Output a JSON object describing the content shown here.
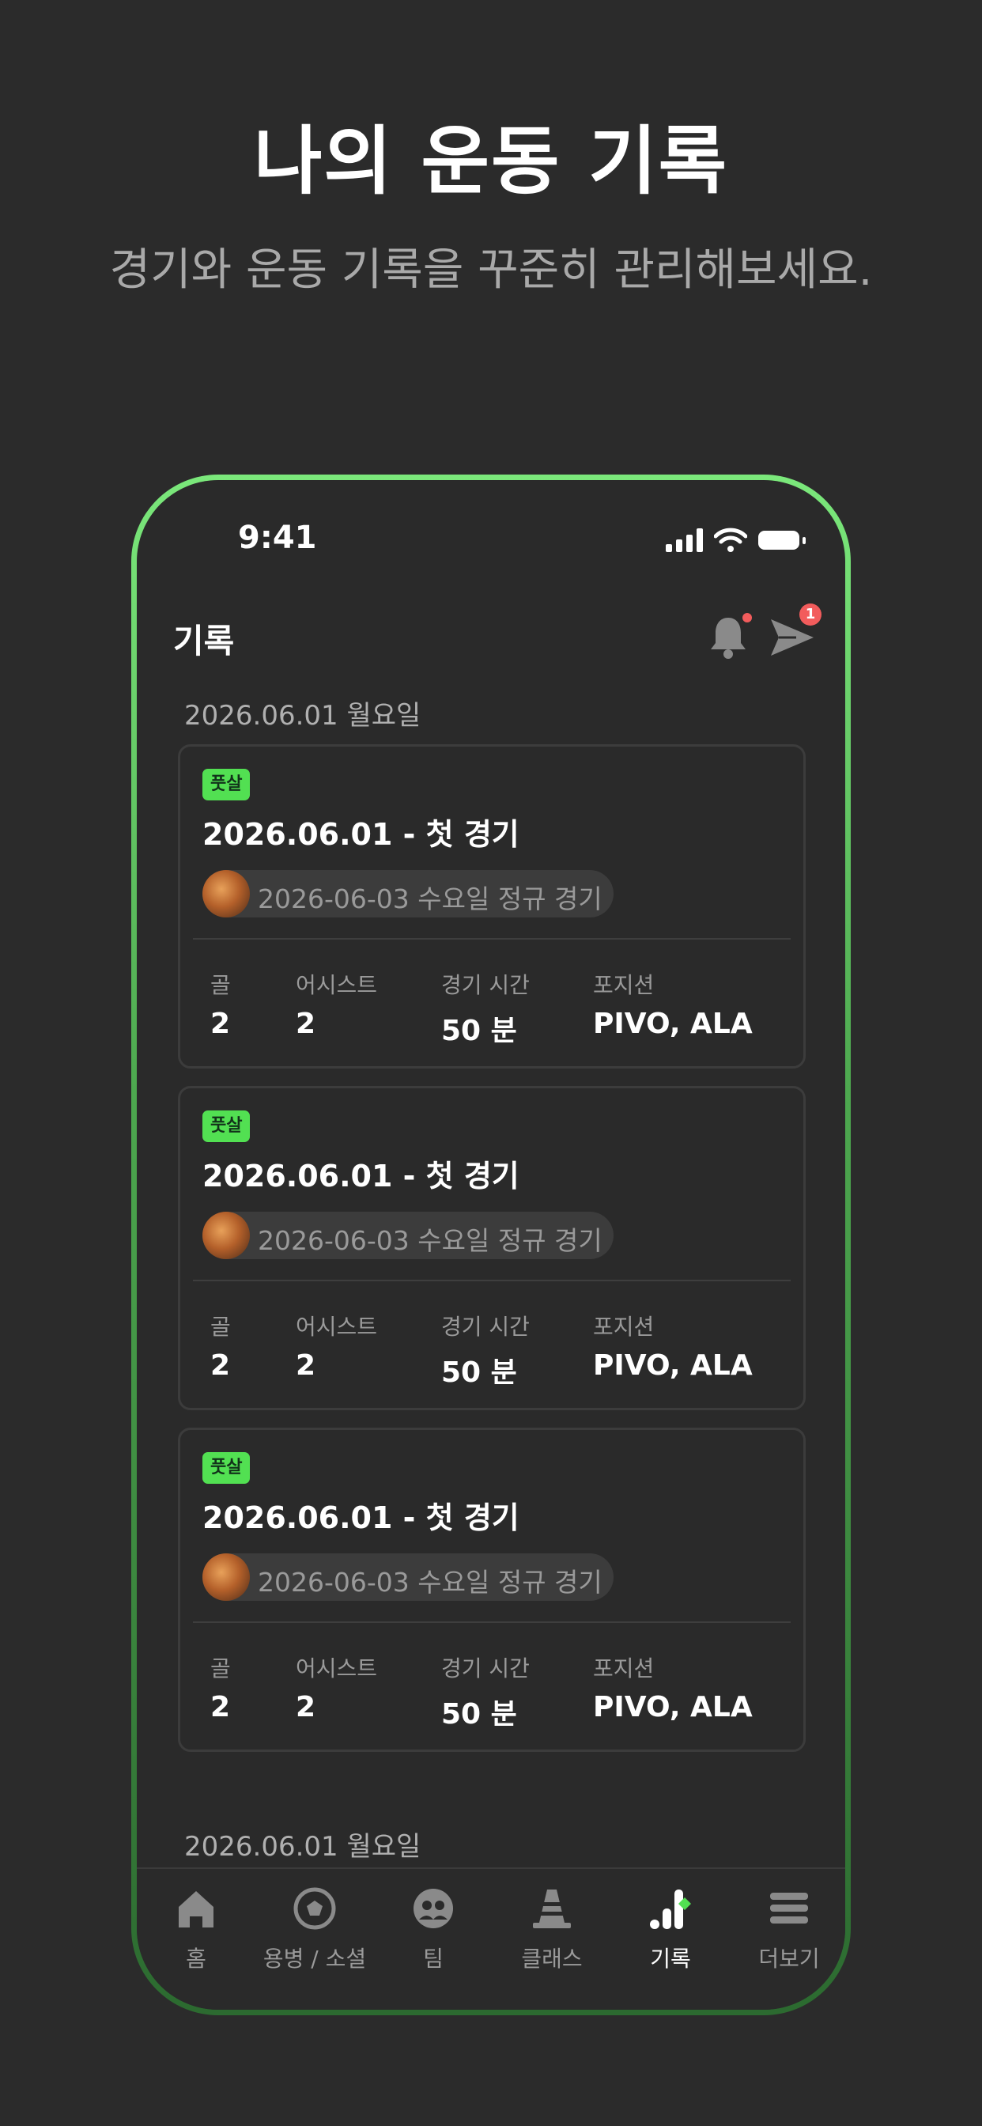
{
  "hero": {
    "title": "나의 운동 기록",
    "subtitle": "경기와 운동 기록을 꾸준히 관리해보세요."
  },
  "status_bar": {
    "time": "9:41"
  },
  "header": {
    "title": "기록",
    "send_badge": "1"
  },
  "sections": [
    {
      "date": "2026.06.01 월요일",
      "cards": [
        {
          "tag": "풋살",
          "title": "2026.06.01 - 첫 경기",
          "match": "2026-06-03 수요일 정규 경기",
          "stats": {
            "goal_label": "골",
            "goal": "2",
            "assist_label": "어시스트",
            "assist": "2",
            "time_label": "경기 시간",
            "time": "50 분",
            "position_label": "포지션",
            "position": "PIVO, ALA"
          }
        },
        {
          "tag": "풋살",
          "title": "2026.06.01 - 첫 경기",
          "match": "2026-06-03 수요일 정규 경기",
          "stats": {
            "goal_label": "골",
            "goal": "2",
            "assist_label": "어시스트",
            "assist": "2",
            "time_label": "경기 시간",
            "time": "50 분",
            "position_label": "포지션",
            "position": "PIVO, ALA"
          }
        },
        {
          "tag": "풋살",
          "title": "2026.06.01 - 첫 경기",
          "match": "2026-06-03 수요일 정규 경기",
          "stats": {
            "goal_label": "골",
            "goal": "2",
            "assist_label": "어시스트",
            "assist": "2",
            "time_label": "경기 시간",
            "time": "50 분",
            "position_label": "포지션",
            "position": "PIVO, ALA"
          }
        }
      ]
    },
    {
      "date": "2026.06.01 월요일"
    }
  ],
  "tabbar": {
    "items": [
      {
        "label": "홈",
        "icon": "home-icon"
      },
      {
        "label": "용병 / 소셜",
        "icon": "soccer-ball-icon"
      },
      {
        "label": "팀",
        "icon": "team-icon"
      },
      {
        "label": "클래스",
        "icon": "cone-icon"
      },
      {
        "label": "기록",
        "icon": "chart-icon",
        "active": true
      },
      {
        "label": "더보기",
        "icon": "menu-icon"
      }
    ]
  },
  "colors": {
    "accent": "#52e052",
    "background": "#2b2b2b",
    "badge": "#f25c5c"
  }
}
